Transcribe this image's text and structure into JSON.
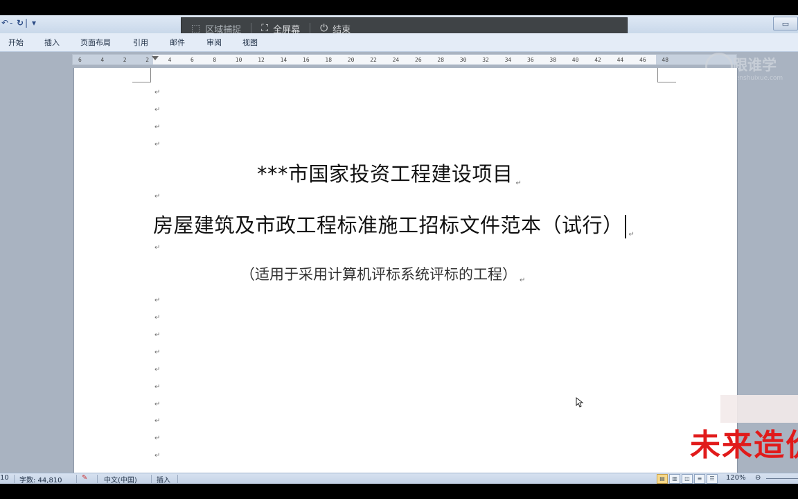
{
  "quick_access": {
    "redo_icon": "redo-icon",
    "customize_glyph": "▾"
  },
  "capture_toolbar": {
    "region_label": "区域捕捉",
    "fullscreen_label": "全屏幕",
    "end_label": "结束"
  },
  "ribbon_tabs": [
    "开始",
    "插入",
    "页面布局",
    "引用",
    "邮件",
    "审阅",
    "视图"
  ],
  "ruler": {
    "ticks": [
      "6",
      "4",
      "2",
      "2",
      "4",
      "6",
      "8",
      "10",
      "12",
      "14",
      "16",
      "18",
      "20",
      "22",
      "24",
      "26",
      "28",
      "30",
      "32",
      "34",
      "36",
      "38",
      "40",
      "42",
      "44",
      "46",
      "48"
    ]
  },
  "document": {
    "title": "***市国家投资工程建设项目",
    "subtitle": "房屋建筑及市政工程标准施工招标文件范本（试行）",
    "note": "（适用于采用计算机评标系统评标的工程）",
    "paragraph_mark": "↵"
  },
  "watermark": {
    "brand": "跟谁学",
    "url": "genshuixue.com",
    "stamp": "未来造价"
  },
  "status_bar": {
    "page_fragment": "10",
    "word_count": "字数: 44,810",
    "language": "中文(中国)",
    "mode": "插入",
    "zoom": "120%"
  }
}
